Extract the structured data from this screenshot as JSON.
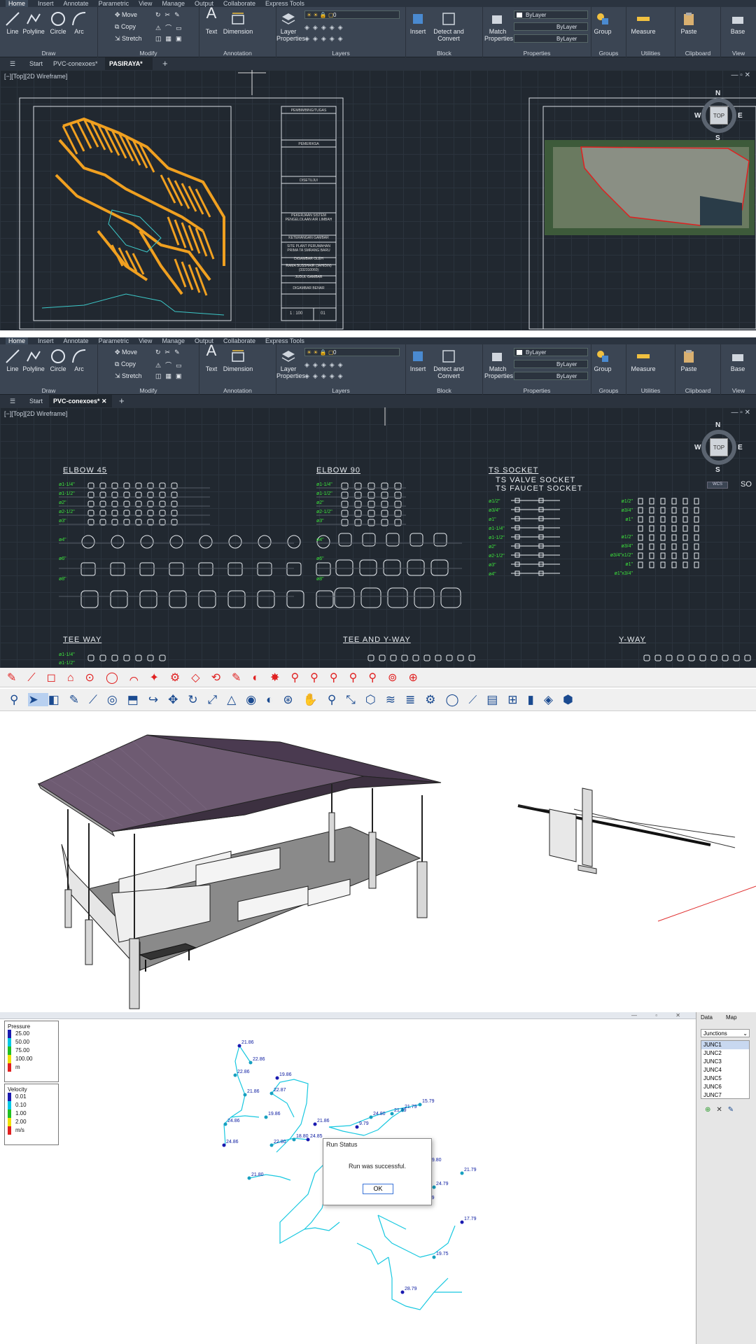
{
  "ribbon": {
    "menu_tabs": [
      "Home",
      "Insert",
      "Annotate",
      "Parametric",
      "View",
      "Manage",
      "Output",
      "Collaborate",
      "Express Tools"
    ],
    "draw": {
      "line": "Line",
      "polyline": "Polyline",
      "circle": "Circle",
      "arc": "Arc",
      "group": "Draw"
    },
    "modify": {
      "move": "Move",
      "copy": "Copy",
      "stretch": "Stretch",
      "group": "Modify"
    },
    "annotation": {
      "text": "Text",
      "dimension": "Dimension",
      "group": "Annotation"
    },
    "layers": {
      "layer_properties": "Layer Properties",
      "current_layer": "0",
      "group": "Layers"
    },
    "block": {
      "insert": "Insert",
      "detect": "Detect and Convert",
      "group": "Block"
    },
    "properties": {
      "match": "Match Properties",
      "color": "ByLayer",
      "linetype": "ByLayer",
      "lineweight": "ByLayer",
      "group": "Properties"
    },
    "groups": {
      "group_btn": "Group",
      "group": "Groups"
    },
    "utilities": {
      "measure": "Measure",
      "group": "Utilities"
    },
    "clipboard": {
      "paste": "Paste",
      "group": "Clipboard"
    },
    "view": {
      "base": "Base",
      "group": "View"
    }
  },
  "panel1": {
    "tabs": [
      "Start",
      "PVC-conexoes*",
      "PASIRAYA*"
    ],
    "active_tab": "PASIRAYA*",
    "viewport_label": "[−][Top][2D Wireframe]",
    "title_block": [
      "PEMBIMBING/TUGAS",
      "PEMERIKSA",
      "DISETUJUI",
      "PEKERJAAN SISTEM PENGELOLAAN AIR LIMBAH",
      "KETERANGAN GAMBAR",
      "SITE PLANT PERUMAHAN PRIMA TA SMRANG BARU",
      "DIGAMBAR OLEH",
      "RAMA SUSSHAIR (JAHIDIN) (332310060)",
      "JUDUL GAMBAR",
      "DIGAMBAR BENAR"
    ],
    "scale": "1 : 100",
    "sheet": "01",
    "compass": {
      "n": "N",
      "s": "S",
      "e": "E",
      "w": "W",
      "top": "TOP"
    }
  },
  "panel2": {
    "tabs": [
      "Start",
      "PVC-conexoes*"
    ],
    "active_tab": "PVC-conexoes*",
    "viewport_label": "[−][Top][2D Wireframe]",
    "headings": {
      "elbow45": "ELBOW 45",
      "elbow90": "ELBOW 90",
      "ts_socket": "TS SOCKET",
      "ts_valve": "TS VALVE SOCKET",
      "ts_faucet": "TS FAUCET SOCKET",
      "tee": "TEE WAY",
      "tee_y": "TEE AND Y-WAY",
      "y_way": "Y-WAY",
      "so": "SO"
    },
    "elbow45_sizes": [
      "ø1-1/4\"",
      "ø1-1/2\"",
      "ø2\"",
      "ø2-1/2\"",
      "ø3\"",
      "ø4\"",
      "ø6\"",
      "ø8\""
    ],
    "elbow90_sizes": [
      "ø1-1/4\"",
      "ø1-1/2\"",
      "ø2\"",
      "ø2-1/2\"",
      "ø3\"",
      "ø4\"",
      "ø6\"",
      "ø8\""
    ],
    "socket_sizes": [
      "ø1/2\"",
      "ø3/4\"",
      "ø1\"",
      "ø1-1/4\"",
      "ø1-1/2\"",
      "ø2\"",
      "ø2-1/2\"",
      "ø3\"",
      "ø4\""
    ],
    "valve_sizes": [
      "ø1/2\"",
      "ø3/4\"",
      "ø1\"",
      "ø1/2\"",
      "ø3/4\"",
      "ø3/4\"x1/2\"",
      "ø1\"",
      "ø1\"x3/4\""
    ],
    "tee_sizes": [
      "ø1-1/4\"",
      "ø1-1/2\""
    ],
    "compass": {
      "n": "N",
      "s": "S",
      "e": "E",
      "w": "W",
      "top": "TOP",
      "wcs": "WCS"
    }
  },
  "panel4": {
    "legend_pressure": {
      "title": "Pressure",
      "values": [
        "25.00",
        "50.00",
        "75.00",
        "100.00"
      ],
      "unit": "m"
    },
    "legend_velocity": {
      "title": "Velocity",
      "values": [
        "0.01",
        "0.10",
        "1.00",
        "2.00"
      ],
      "unit": "m/s"
    },
    "right_tabs": [
      "Data",
      "Map"
    ],
    "dropdown": "Junctions",
    "junctions": [
      "JUNC1",
      "JUNC2",
      "JUNC3",
      "JUNC4",
      "JUNC5",
      "JUNC6",
      "JUNC7"
    ],
    "dialog": {
      "title": "Run Status",
      "message": "Run was successful.",
      "ok": "OK"
    },
    "node_labels": [
      "21.86",
      "22.86",
      "22.86",
      "19.86",
      "24.86",
      "21.86",
      "24.86",
      "19.86",
      "22.87",
      "21.86",
      "22.80",
      "18.80",
      "24.85",
      "15.79",
      "21.79",
      "9.79",
      "24.80",
      "21.79",
      "19.80",
      "21.79",
      "24.79",
      "17.79",
      "20.79",
      "19.75",
      "28.79",
      "18.79",
      "21.80"
    ]
  },
  "colors": {
    "cad_bg": "#212830",
    "map_orange": "#f0a020",
    "legend_colors": [
      "#1a1ab0",
      "#00c8e6",
      "#20c020",
      "#f0e000",
      "#e02020"
    ]
  }
}
